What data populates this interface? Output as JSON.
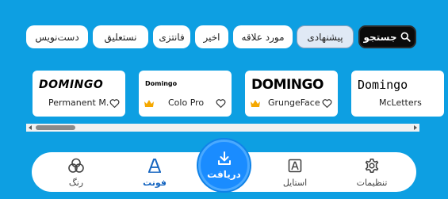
{
  "filter_chips": {
    "search_label": "جستجو",
    "selected_label": "پیشنهادی",
    "items": [
      "مورد علاقه",
      "اخیر",
      "فانتزی",
      "نستعلیق",
      "دست‌نویس"
    ]
  },
  "fonts": [
    {
      "sample": "Domingo",
      "name": "McLetters",
      "premium": false
    },
    {
      "sample": "DOMINGO",
      "name": "GrungeFace",
      "premium": true
    },
    {
      "sample": "Domingo",
      "name": "Colo Pro",
      "premium": true
    },
    {
      "sample": "DOMINGO",
      "name": "Permanent M…",
      "premium": false
    }
  ],
  "bottom_nav": {
    "settings_label": "تنظیمات",
    "style_label": "استایل",
    "download_label": "دریافت",
    "font_label": "فونت",
    "color_label": "رنگ"
  },
  "colors": {
    "background": "#0d9fe2",
    "accent": "#1a8cff",
    "active_tab": "#1565c0",
    "premium": "#f5a800"
  }
}
